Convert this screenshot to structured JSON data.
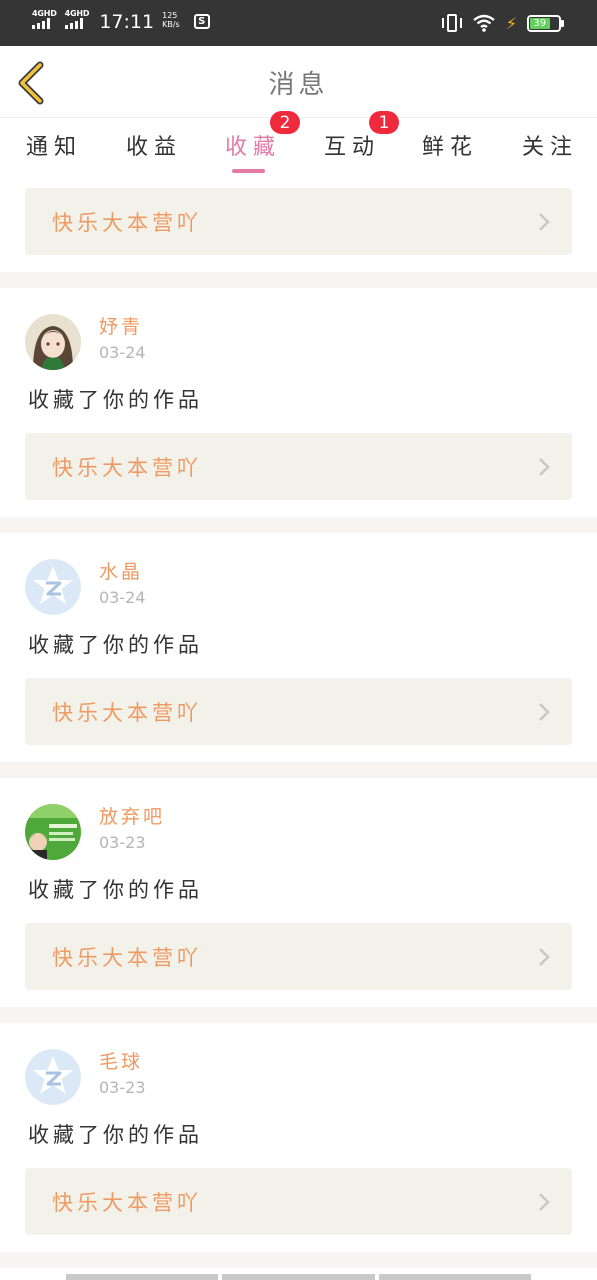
{
  "status_bar": {
    "sim1": "4GHD",
    "sim2": "4GHD",
    "time": "17:11",
    "speed_value": "125",
    "speed_unit": "KB/s",
    "battery": "39"
  },
  "header": {
    "title": "消息"
  },
  "tabs": [
    {
      "label": "通知"
    },
    {
      "label": "收益"
    },
    {
      "label": "收藏",
      "badge": "2"
    },
    {
      "label": "互动",
      "badge": "1"
    },
    {
      "label": "鲜花"
    },
    {
      "label": "关注"
    }
  ],
  "active_tab": "收藏",
  "accent_color": "#e47ba4",
  "name_color": "#ef9a63",
  "top_banner": {
    "text": "快乐大本营吖"
  },
  "items": [
    {
      "name": "妤青",
      "date": "03-24",
      "action": "收藏了你的作品",
      "work": "快乐大本营吖",
      "avatar": "anime-girl-avatar"
    },
    {
      "name": "水晶",
      "date": "03-24",
      "action": "收藏了你的作品",
      "work": "快乐大本营吖",
      "avatar": "default-qq-avatar"
    },
    {
      "name": "放弃吧",
      "date": "03-23",
      "action": "收藏了你的作品",
      "work": "快乐大本营吖",
      "avatar": "photo-avatar"
    },
    {
      "name": "毛球",
      "date": "03-23",
      "action": "收藏了你的作品",
      "work": "快乐大本营吖",
      "avatar": "default-qq-avatar"
    }
  ]
}
